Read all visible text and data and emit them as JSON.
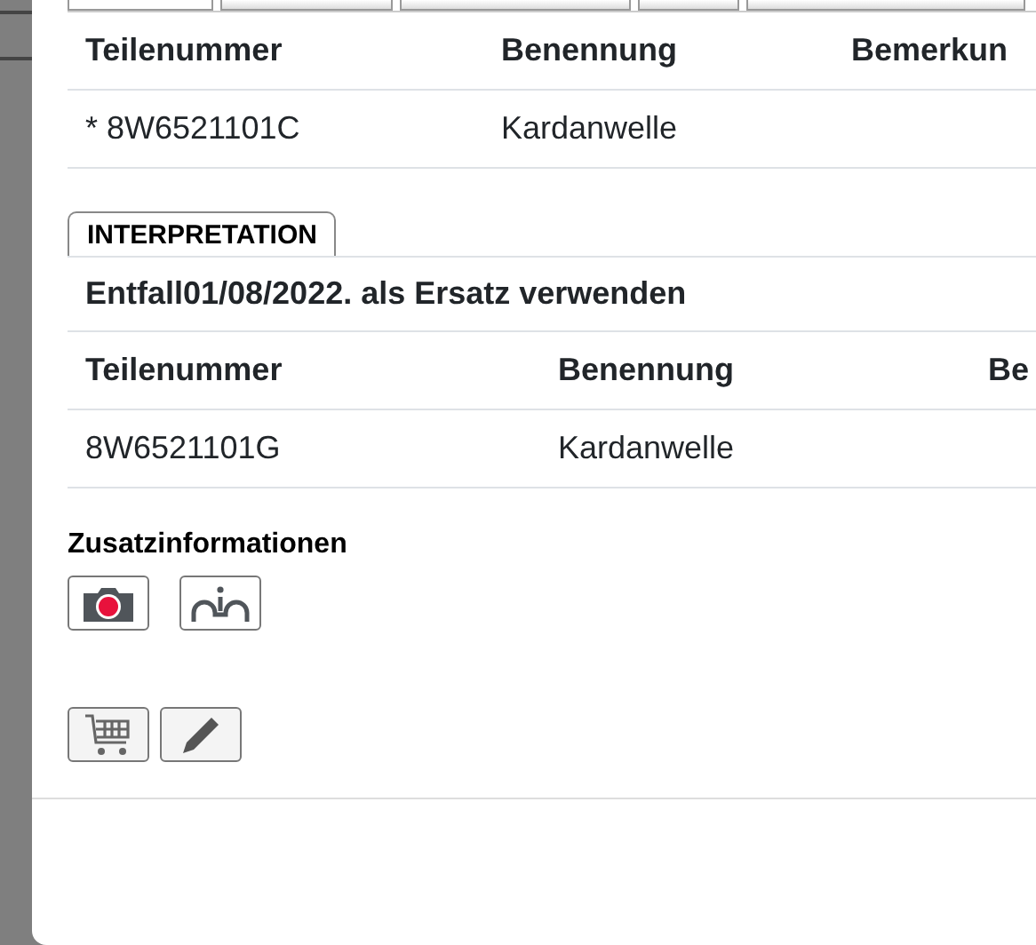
{
  "tabs": [
    {
      "selected": true
    },
    {
      "selected": false
    },
    {
      "selected": false
    },
    {
      "selected": false
    },
    {
      "selected": false
    }
  ],
  "parts_table": {
    "columns": [
      "Teilenummer",
      "Benennung",
      "Bemerkun"
    ],
    "rows": [
      [
        "* 8W6521101C",
        "Kardanwelle",
        ""
      ]
    ]
  },
  "interpretation": {
    "tab_label": "INTERPRETATION",
    "note": "Entfall01/08/2022. als Ersatz verwenden",
    "columns": [
      "Teilenummer",
      "Benennung",
      "Be"
    ],
    "rows": [
      [
        "8W6521101G",
        "Kardanwelle",
        ""
      ]
    ]
  },
  "additional_info": {
    "title": "Zusatzinformationen"
  }
}
